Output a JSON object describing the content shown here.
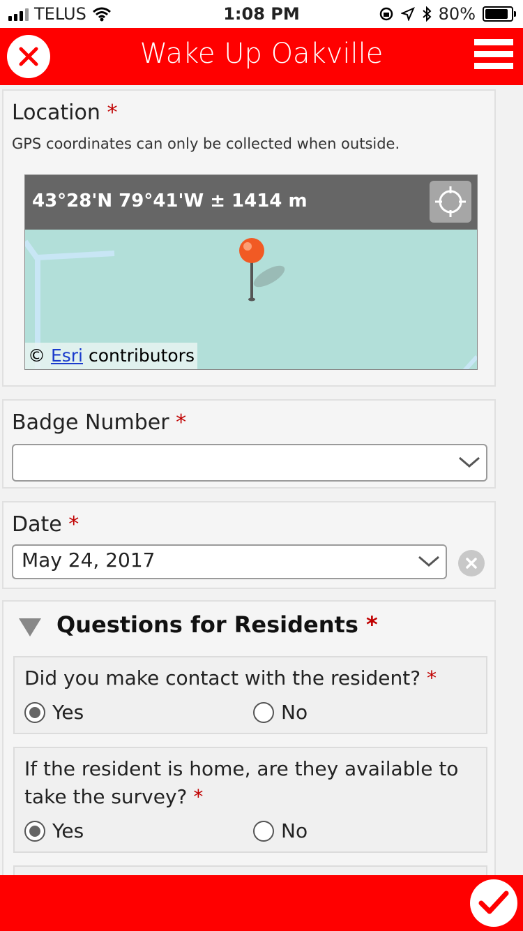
{
  "status_bar": {
    "carrier": "TELUS",
    "time": "1:08 PM",
    "battery_percent": "80%"
  },
  "header": {
    "title": "Wake Up Oakville",
    "close_icon": "close-icon",
    "menu_icon": "hamburger-menu-icon",
    "accent_color": "#ff0000"
  },
  "location": {
    "label": "Location",
    "required_mark": "*",
    "hint": "GPS coordinates can only be collected when outside.",
    "coordinates": "43°28'N 79°41'W ± 1414 m",
    "attribution_prefix": "©",
    "attribution_link": "Esri",
    "attribution_suffix": "contributors"
  },
  "badge_number": {
    "label": "Badge Number",
    "required_mark": "*",
    "value": ""
  },
  "date": {
    "label": "Date",
    "required_mark": "*",
    "value": "May 24, 2017"
  },
  "questions_group": {
    "title": "Questions for Residents",
    "required_mark": "*",
    "questions": [
      {
        "text": "Did you make contact with the resident?",
        "required_mark": "*",
        "options": [
          "Yes",
          "No"
        ],
        "selected": "Yes"
      },
      {
        "text": "If the resident is home, are they available to take the survey?",
        "required_mark": "*",
        "options": [
          "Yes",
          "No"
        ],
        "selected": "Yes"
      }
    ]
  },
  "footer": {
    "submit_icon": "checkmark-icon"
  }
}
